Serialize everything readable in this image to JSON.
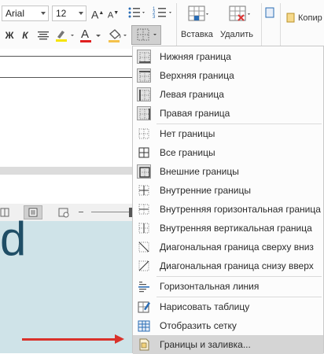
{
  "ribbon": {
    "font_name": "Arial",
    "font_size": "12",
    "bold": "Ж",
    "italic": "К",
    "font_color_letter": "A",
    "grow_font": "A",
    "shrink_font": "A",
    "insert_label": "Вставка",
    "delete_label": "Удалить",
    "copy_label": "Копир"
  },
  "menu": {
    "items": [
      {
        "label": "Нижняя граница",
        "icon": "border-bottom-icon"
      },
      {
        "label": "Верхняя граница",
        "icon": "border-top-icon"
      },
      {
        "label": "Левая граница",
        "icon": "border-left-icon"
      },
      {
        "label": "Правая граница",
        "icon": "border-right-icon"
      },
      {
        "label": "Нет границы",
        "icon": "no-border-icon"
      },
      {
        "label": "Все границы",
        "icon": "all-borders-icon"
      },
      {
        "label": "Внешние границы",
        "icon": "outside-borders-icon"
      },
      {
        "label": "Внутренние границы",
        "icon": "inside-borders-icon"
      },
      {
        "label": "Внутренняя горизонтальная граница",
        "icon": "inside-horizontal-border-icon"
      },
      {
        "label": "Внутренняя вертикальная граница",
        "icon": "inside-vertical-border-icon"
      },
      {
        "label": "Диагональная граница сверху вниз",
        "icon": "diagonal-down-border-icon"
      },
      {
        "label": "Диагональная граница снизу вверх",
        "icon": "diagonal-up-border-icon"
      },
      {
        "label": "Горизонтальная линия",
        "icon": "horizontal-line-icon"
      },
      {
        "label": "Нарисовать таблицу",
        "icon": "draw-table-icon"
      },
      {
        "label": "Отобразить сетку",
        "icon": "view-gridlines-icon"
      },
      {
        "label": "Границы и заливка...",
        "icon": "borders-and-shading-icon"
      }
    ],
    "highlighted_index": 15,
    "accent_color": "#d9322b"
  },
  "slide": {
    "visible_text": "d"
  }
}
